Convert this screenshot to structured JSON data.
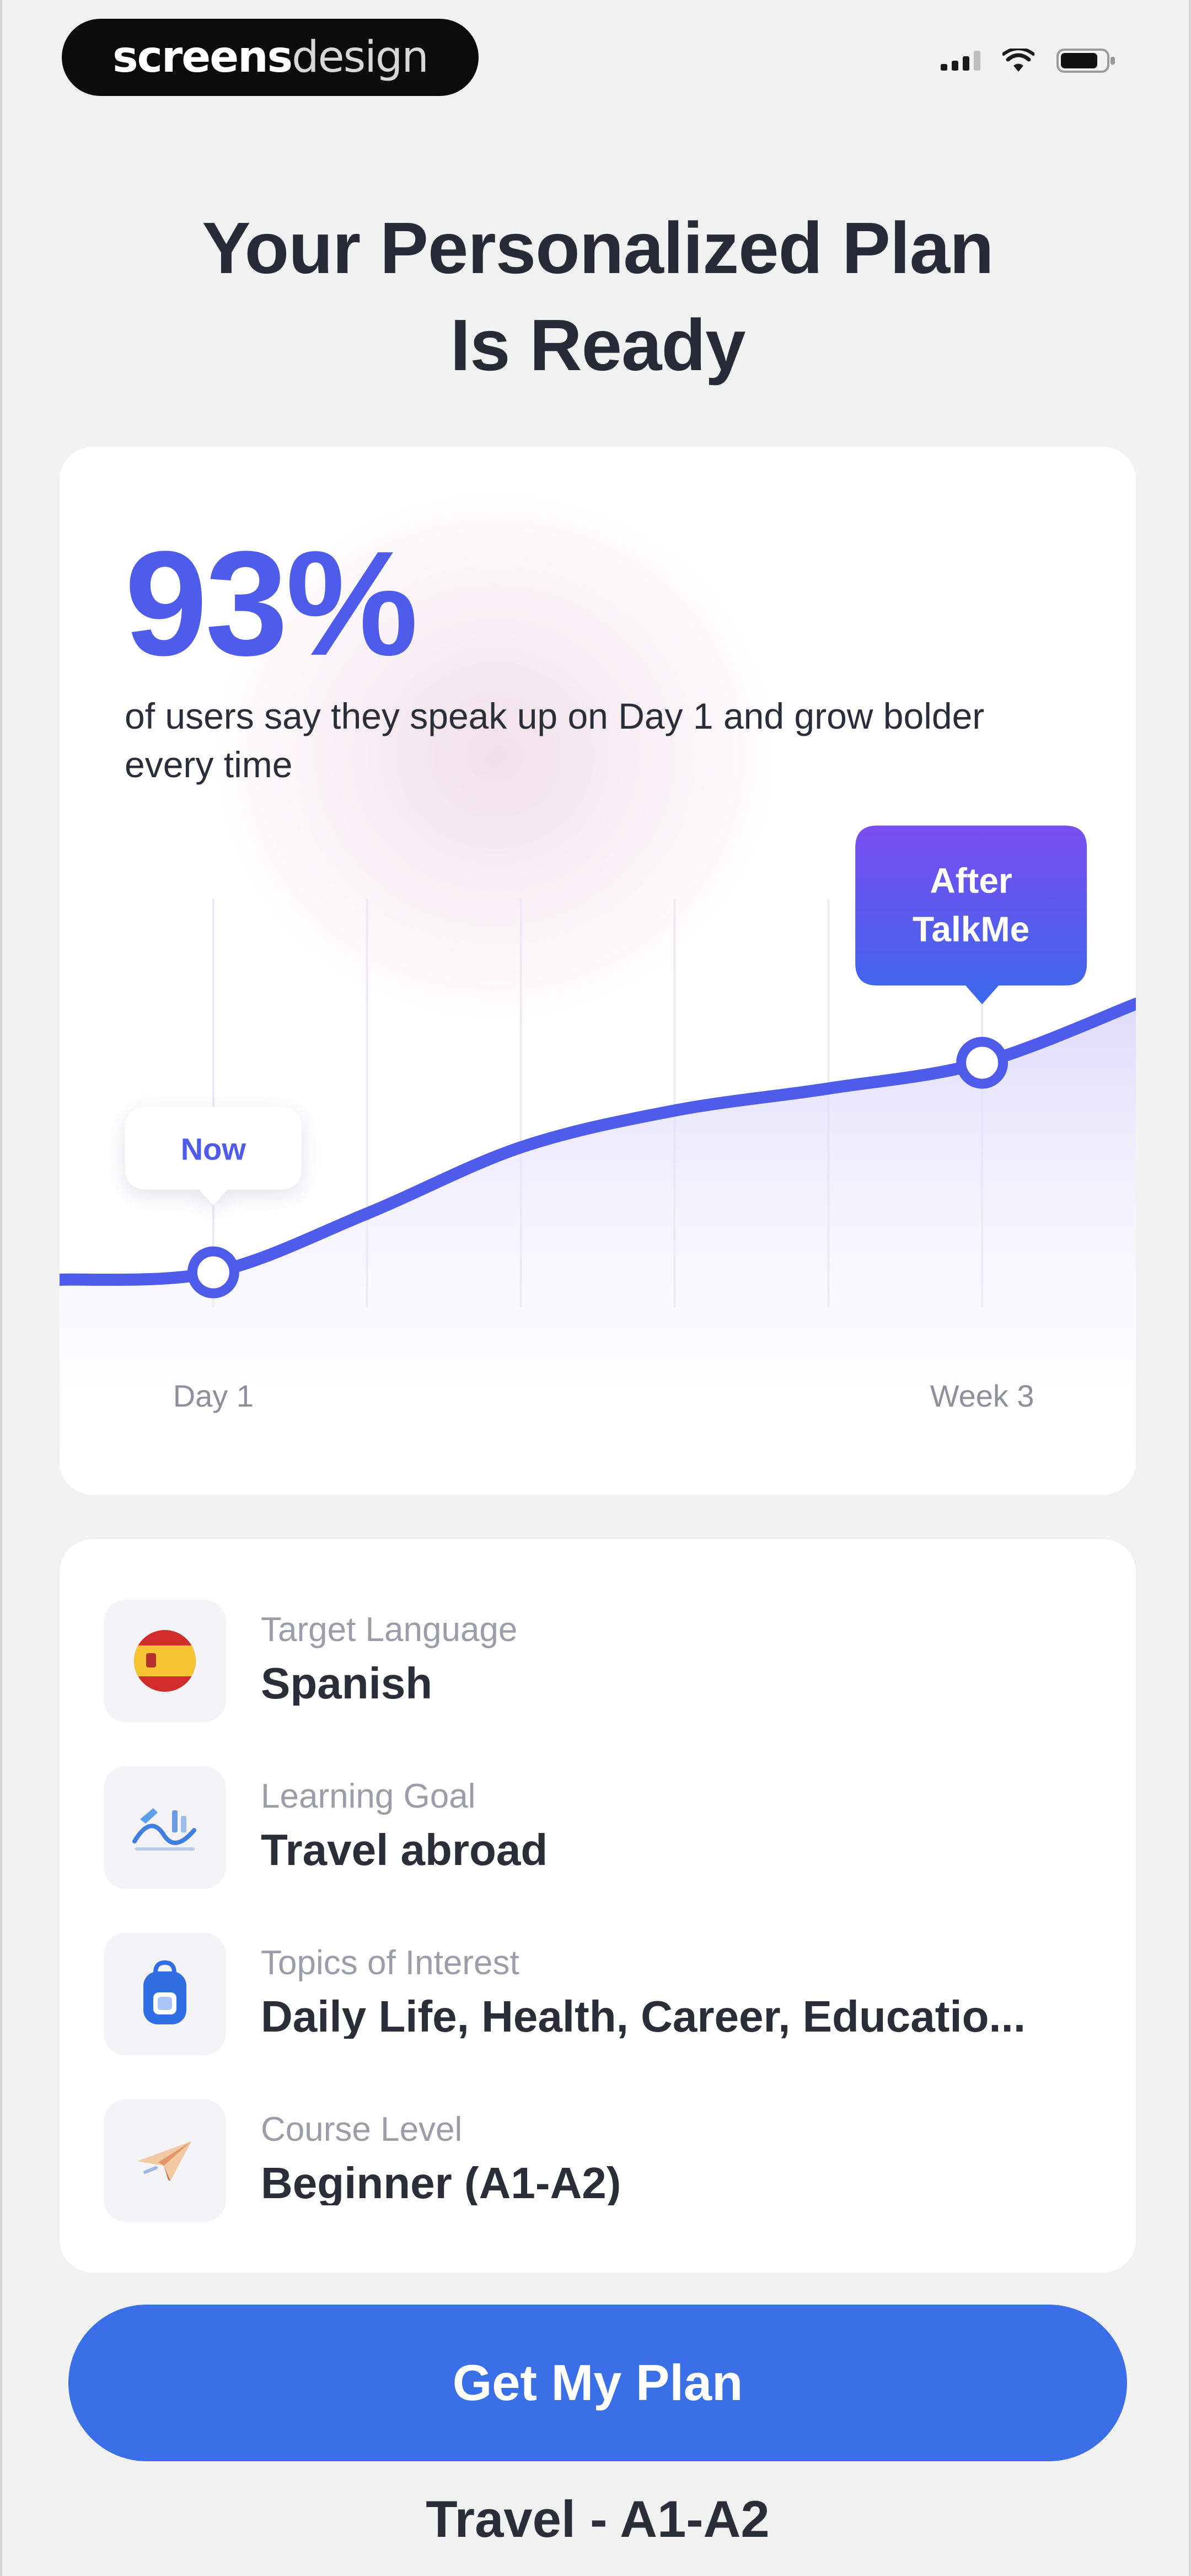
{
  "status_bar": {
    "brand_bold": "screens",
    "brand_light": "design"
  },
  "header": {
    "title_line1": "Your Personalized Plan",
    "title_line2": "Is Ready"
  },
  "stat": {
    "value": "93%",
    "caption": "of users say they speak up on Day 1 and grow bolder every time"
  },
  "chart_data": {
    "type": "line",
    "x_labels": [
      "Day 1",
      "Week 3"
    ],
    "markers": [
      {
        "label": "Now",
        "x_label": "Day 1"
      },
      {
        "label_line1": "After",
        "label_line2": "TalkMe",
        "x_label": "Week 3"
      }
    ],
    "series": [
      {
        "values": [
          0.0,
          0.02,
          0.18,
          0.36,
          0.46,
          0.52,
          0.59,
          0.75
        ]
      }
    ],
    "colors": {
      "line": "#4f5be9",
      "fill": "#d9d5fb",
      "tooltip_start": "#7a4ef0",
      "tooltip_end": "#3b68ea"
    }
  },
  "details": [
    {
      "label": "Target Language",
      "value": "Spanish",
      "icon": "spain-flag-icon"
    },
    {
      "label": "Learning Goal",
      "value": "Travel abroad",
      "icon": "travel-icon"
    },
    {
      "label": "Topics of Interest",
      "value": "Daily Life, Health, Career, Educatio...",
      "icon": "backpack-icon"
    },
    {
      "label": "Course Level",
      "value": "Beginner (A1-A2)",
      "icon": "paper-plane-icon"
    }
  ],
  "cta": {
    "label": "Get My Plan",
    "color": "#3a6fe8"
  },
  "plan_summary": "Travel - A1-A2"
}
